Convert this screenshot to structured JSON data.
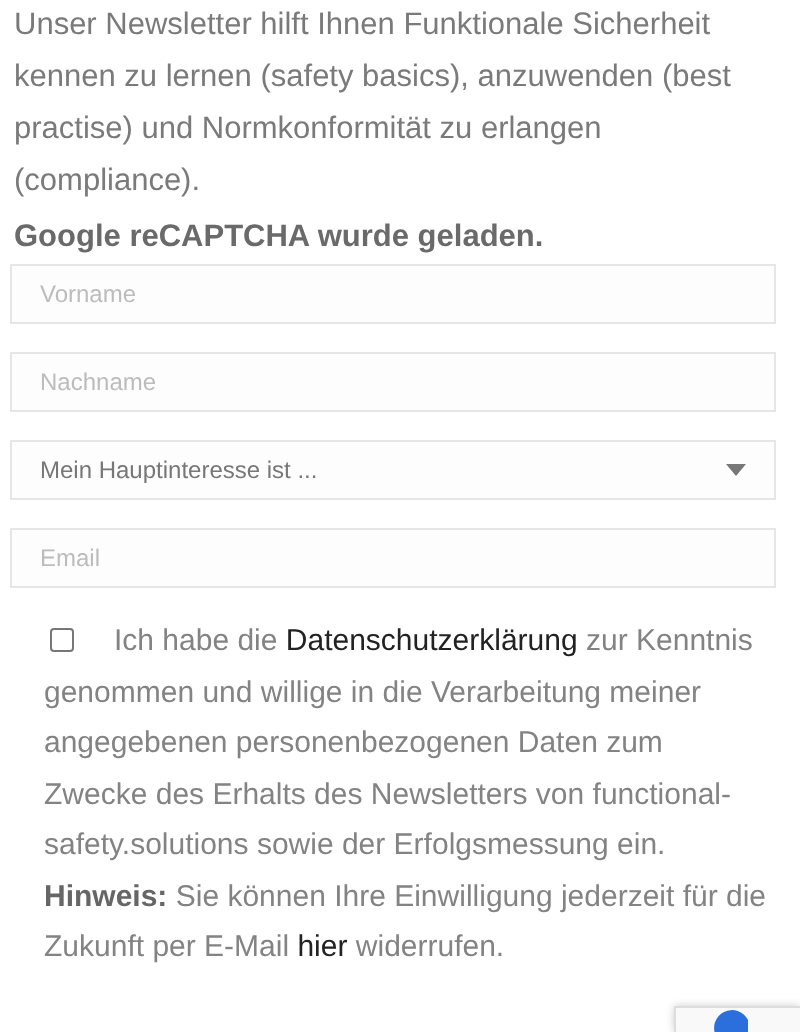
{
  "intro": "Unser Newsletter hilft Ihnen Funktionale Sicherheit kennen zu lernen (safety basics), anzuwenden (best practise) und Normkonformität zu erlangen (compliance).",
  "captcha_notice": "Google reCAPTCHA wurde geladen.",
  "fields": [
    {
      "kind": "text",
      "placeholder": "Vorname"
    },
    {
      "kind": "text",
      "placeholder": "Nachname"
    },
    {
      "kind": "select",
      "value": "Mein Hauptinteresse ist ..."
    },
    {
      "kind": "text",
      "placeholder": "Email"
    }
  ],
  "consent": {
    "checked": false,
    "parts": [
      {
        "kind": "text",
        "text": "Ich habe die "
      },
      {
        "kind": "link",
        "text": "Datenschutzerklärung"
      },
      {
        "kind": "text",
        "text": " zur Kenntnis genommen und willige in die Verarbeitung meiner angegebenen personenbezogenen Daten zum Zwecke des Erhalts des Newsletters von functional-safety.solutions sowie der Erfolgsmessung ein. "
      },
      {
        "kind": "bold",
        "text": "Hinweis:"
      },
      {
        "kind": "text",
        "text": " Sie können Ihre Einwilligung jederzeit für die Zukunft per E-Mail "
      },
      {
        "kind": "link",
        "text": "hier"
      },
      {
        "kind": "text",
        "text": " widerrufen."
      }
    ]
  }
}
